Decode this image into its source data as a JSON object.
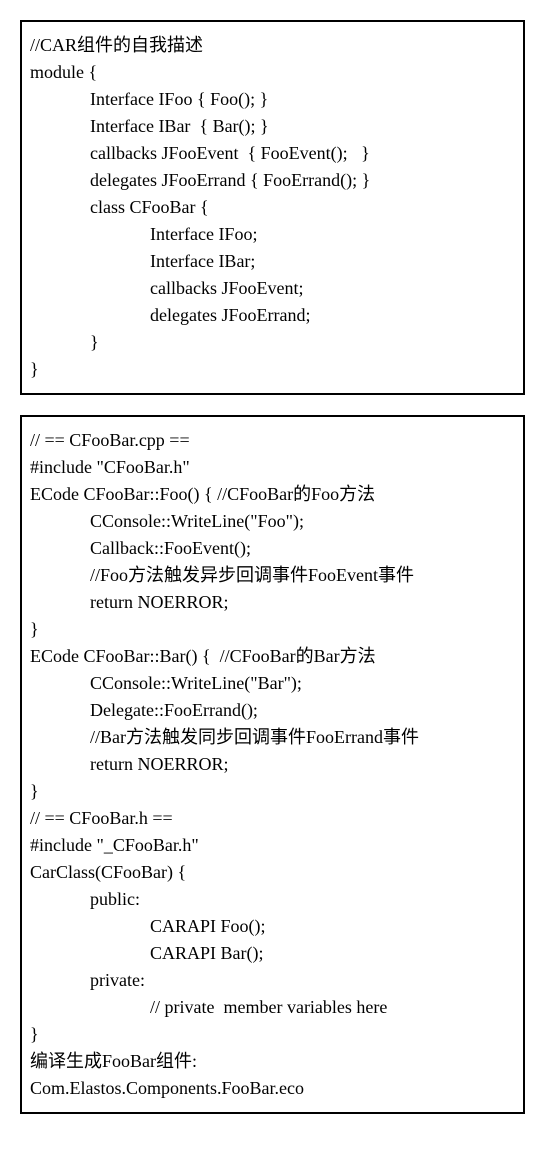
{
  "box1": {
    "lines": [
      {
        "indent": 1,
        "text": "//CAR组件的自我描述"
      },
      {
        "indent": 1,
        "text": "module {"
      },
      {
        "indent": 2,
        "text": "Interface IFoo { Foo(); }"
      },
      {
        "indent": 2,
        "text": "Interface IBar  { Bar(); }"
      },
      {
        "indent": 2,
        "text": "callbacks JFooEvent  { FooEvent();   }"
      },
      {
        "indent": 2,
        "text": "delegates JFooErrand { FooErrand(); }"
      },
      {
        "indent": 2,
        "text": "class CFooBar {"
      },
      {
        "indent": 3,
        "text": "Interface IFoo;"
      },
      {
        "indent": 3,
        "text": "Interface IBar;"
      },
      {
        "indent": 3,
        "text": "callbacks JFooEvent;"
      },
      {
        "indent": 3,
        "text": "delegates JFooErrand;"
      },
      {
        "indent": 2,
        "text": "}"
      },
      {
        "indent": 1,
        "text": "}"
      }
    ]
  },
  "box2": {
    "lines": [
      {
        "indent": 1,
        "text": "// == CFooBar.cpp =="
      },
      {
        "indent": 1,
        "text": "#include \"CFooBar.h\""
      },
      {
        "indent": 1,
        "text": "ECode CFooBar::Foo() { //CFooBar的Foo方法"
      },
      {
        "indent": 2,
        "text": "CConsole::WriteLine(\"Foo\");"
      },
      {
        "indent": 2,
        "text": "Callback::FooEvent();"
      },
      {
        "indent": 2,
        "text": "//Foo方法触发异步回调事件FooEvent事件"
      },
      {
        "indent": 2,
        "text": "return NOERROR;"
      },
      {
        "indent": 1,
        "text": "}"
      },
      {
        "indent": 1,
        "text": "ECode CFooBar::Bar() {  //CFooBar的Bar方法"
      },
      {
        "indent": 2,
        "text": "CConsole::WriteLine(\"Bar\");"
      },
      {
        "indent": 2,
        "text": "Delegate::FooErrand();"
      },
      {
        "indent": 2,
        "text": "//Bar方法触发同步回调事件FooErrand事件"
      },
      {
        "indent": 2,
        "text": "return NOERROR;"
      },
      {
        "indent": 1,
        "text": "}"
      },
      {
        "indent": 1,
        "text": "// == CFooBar.h =="
      },
      {
        "indent": 1,
        "text": "#include \"_CFooBar.h\""
      },
      {
        "indent": 1,
        "text": "CarClass(CFooBar) {"
      },
      {
        "indent": 2,
        "text": "public:"
      },
      {
        "indent": 3,
        "text": "CARAPI Foo();"
      },
      {
        "indent": 3,
        "text": "CARAPI Bar();"
      },
      {
        "indent": 2,
        "text": "private:"
      },
      {
        "indent": 3,
        "text": "// private  member variables here"
      },
      {
        "indent": 1,
        "text": "}"
      },
      {
        "indent": 1,
        "text": "编译生成FooBar组件:"
      },
      {
        "indent": 1,
        "text": "Com.Elastos.Components.FooBar.eco"
      }
    ]
  }
}
